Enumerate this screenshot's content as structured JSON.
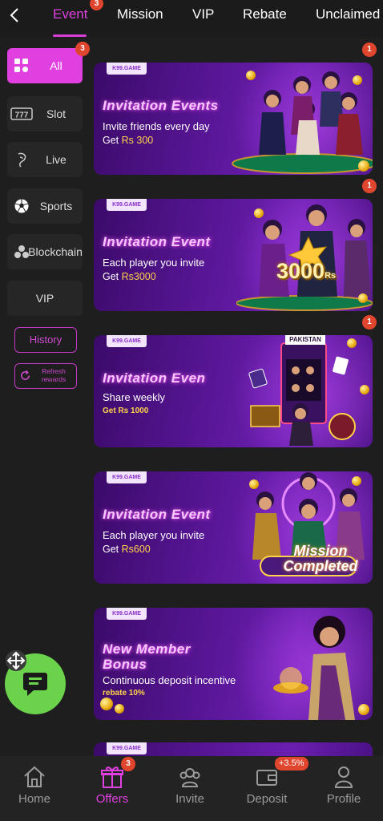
{
  "header": {
    "tabs": [
      {
        "label": "Event",
        "badge": "3"
      },
      {
        "label": "Mission"
      },
      {
        "label": "VIP"
      },
      {
        "label": "Rebate"
      },
      {
        "label": "Unclaimed"
      }
    ]
  },
  "sidebar": {
    "items": [
      {
        "label": "All",
        "icon": "grid-icon",
        "badge": "3"
      },
      {
        "label": "Slot",
        "icon": "slot-777-icon"
      },
      {
        "label": "Live",
        "icon": "dealer-icon"
      },
      {
        "label": "Sports",
        "icon": "soccer-ball-icon"
      },
      {
        "label": "Blockchain",
        "icon": "blockchain-icon"
      },
      {
        "label": "VIP"
      }
    ],
    "history_label": "History",
    "refresh_label": "Refresh rewards"
  },
  "banners": [
    {
      "tag": "K99.GAME",
      "title": "Invitation Events",
      "line1": "Invite friends every day",
      "line2_prefix": "Get ",
      "line2_amount": "Rs 300",
      "badge": "1"
    },
    {
      "tag": "K99.GAME",
      "title": "Invitation Event",
      "line1": "Each player you invite",
      "line2_prefix": "Get ",
      "line2_amount": "Rs3000",
      "art_text": "3000",
      "art_sub": "Rs",
      "badge": "1"
    },
    {
      "tag": "K99.GAME",
      "title": "Invitation Even",
      "line1": "Share weekly",
      "small": "Get Rs 1000",
      "art_text": "PAKISTAN",
      "badge": "1"
    },
    {
      "tag": "K99.GAME",
      "title": "Invitation Event",
      "line1": "Each player you invite",
      "line2_prefix": "Get ",
      "line2_amount": "Rs600",
      "art_text": "Mission Completed"
    },
    {
      "tag": "K99.GAME",
      "title": "New Member Bonus",
      "line1": "Continuous deposit incentive",
      "small": "rebate 10%"
    },
    {
      "tag": "K99.GAME"
    }
  ],
  "bottom_nav": [
    {
      "label": "Home",
      "icon": "home-icon"
    },
    {
      "label": "Offers",
      "icon": "gift-icon",
      "badge": "3",
      "active": true
    },
    {
      "label": "Invite",
      "icon": "invite-icon"
    },
    {
      "label": "Deposit",
      "icon": "wallet-icon",
      "badge": "+3.5%"
    },
    {
      "label": "Profile",
      "icon": "profile-icon"
    }
  ],
  "colors": {
    "accent": "#e040e0",
    "badge": "#e0452e",
    "chat_button": "#6bd34b",
    "banner_purple": "#5a1799",
    "gold": "#ffd24a"
  }
}
